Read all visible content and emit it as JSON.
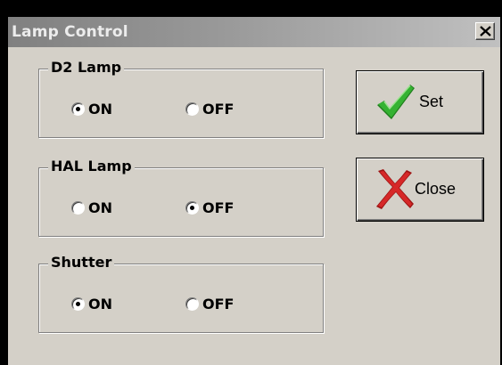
{
  "window": {
    "title": "Lamp Control",
    "close_glyph": "x"
  },
  "groups": [
    {
      "label": "D2 Lamp",
      "on_label": "ON",
      "off_label": "OFF",
      "selected": "on"
    },
    {
      "label": "HAL Lamp",
      "on_label": "ON",
      "off_label": "OFF",
      "selected": "off"
    },
    {
      "label": "Shutter",
      "on_label": "ON",
      "off_label": "OFF",
      "selected": "on"
    }
  ],
  "buttons": {
    "set": {
      "label": "Set",
      "icon": "green-checkmark-icon",
      "color": "#2fa82b"
    },
    "close": {
      "label": "Close",
      "icon": "red-x-icon",
      "color": "#c81e1e"
    }
  }
}
